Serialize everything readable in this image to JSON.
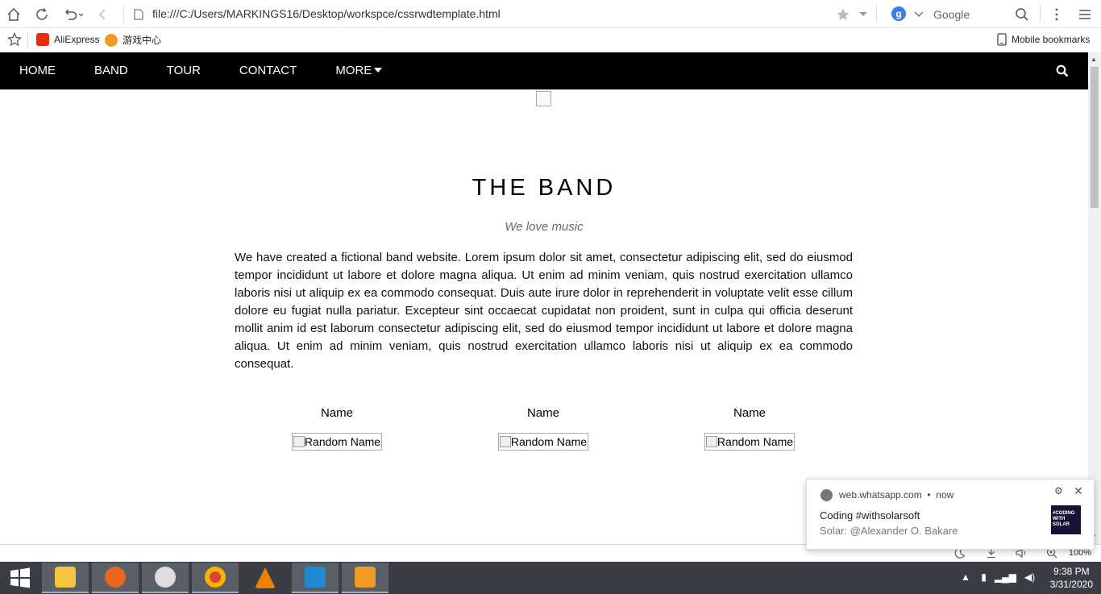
{
  "browser": {
    "url": "file:///C:/Users/MARKINGS16/Desktop/workspce/cssrwdtemplate.html",
    "search_engine": "Google",
    "bookmarks": [
      {
        "label": "AliExpress",
        "color": "#e62e04"
      },
      {
        "label": "游戏中心",
        "color": "#f29b22"
      }
    ],
    "mobile_bookmarks": "Mobile bookmarks",
    "zoom": "100%"
  },
  "site": {
    "nav": [
      {
        "label": "HOME"
      },
      {
        "label": "BAND"
      },
      {
        "label": "TOUR"
      },
      {
        "label": "CONTACT"
      },
      {
        "label": "MORE"
      }
    ],
    "band": {
      "title": "THE BAND",
      "subtitle": "We love music",
      "paragraph": "We have created a fictional band website. Lorem ipsum dolor sit amet, consectetur adipiscing elit, sed do eiusmod tempor incididunt ut labore et dolore magna aliqua. Ut enim ad minim veniam, quis nostrud exercitation ullamco laboris nisi ut aliquip ex ea commodo consequat. Duis aute irure dolor in reprehenderit in voluptate velit esse cillum dolore eu fugiat nulla pariatur. Excepteur sint occaecat cupidatat non proident, sunt in culpa qui officia deserunt mollit anim id est laborum consectetur adipiscing elit, sed do eiusmod tempor incididunt ut labore et dolore magna aliqua. Ut enim ad minim veniam, quis nostrud exercitation ullamco laboris nisi ut aliquip ex ea commodo consequat."
    },
    "members": [
      {
        "name": "Name",
        "img_alt": "Random Name"
      },
      {
        "name": "Name",
        "img_alt": "Random Name"
      },
      {
        "name": "Name",
        "img_alt": "Random Name"
      }
    ]
  },
  "notification": {
    "source": "web.whatsapp.com",
    "time": "now",
    "title": "Coding #withsolarsoft",
    "body": "Solar: @Alexander O. Bakare",
    "thumb_text": "#CODING WITH SOLAR"
  },
  "taskbar": {
    "time": "9:38 PM",
    "date": "3/31/2020",
    "apps": [
      "file-explorer",
      "firefox",
      "snipping-tool",
      "chrome",
      "vlc",
      "vscode",
      "uc-browser"
    ]
  }
}
